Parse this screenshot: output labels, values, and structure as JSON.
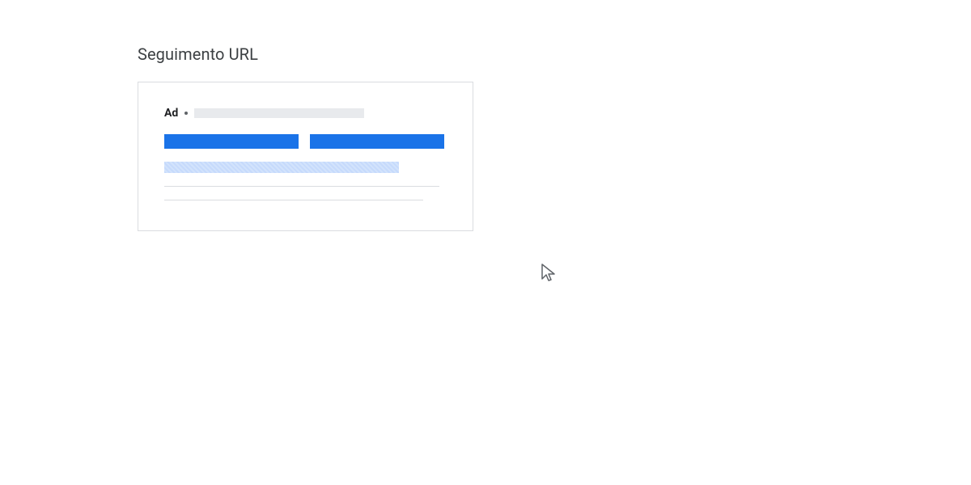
{
  "title": "Seguimento URL",
  "ad": {
    "label": "Ad"
  }
}
